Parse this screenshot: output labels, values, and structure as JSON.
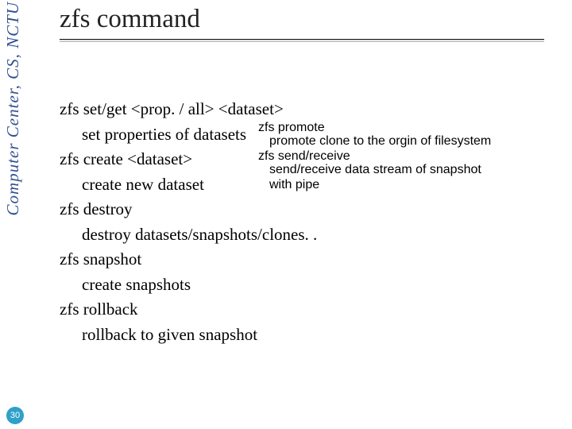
{
  "sidebar": {
    "label": "Computer Center, CS, NCTU"
  },
  "title": "zfs command",
  "content": {
    "cmd1": "zfs set/get <prop. / all> <dataset>",
    "desc1": "set properties of datasets",
    "cmd2": "zfs create <dataset>",
    "desc2": "create new dataset",
    "cmd3": "zfs destroy",
    "desc3": "destroy datasets/snapshots/clones. .",
    "cmd4": "zfs snapshot",
    "desc4": "create snapshots",
    "cmd5": "zfs rollback",
    "desc5": "rollback to given snapshot"
  },
  "sidecol": {
    "cmdA": "zfs promote",
    "descA": "promote clone to the orgin of filesystem",
    "cmdB": "zfs send/receive",
    "descB1": "send/receive data stream of snapshot",
    "descB2": "with pipe"
  },
  "page_number": "30"
}
